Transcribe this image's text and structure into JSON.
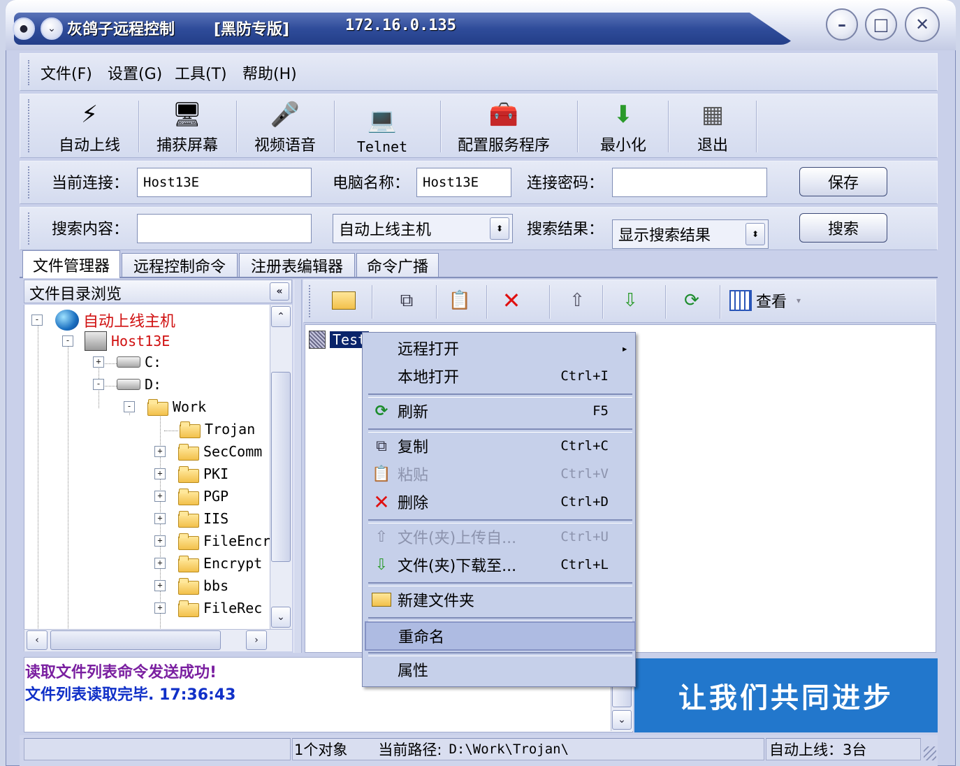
{
  "window": {
    "app_title": "灰鸽子远程控制",
    "edition": "[黑防专版]",
    "ip": "172.16.0.135",
    "min_label": "–",
    "max_label": "□",
    "close_label": "✕"
  },
  "menu": [
    "文件(F)",
    "设置(G)",
    "工具(T)",
    "帮助(H)"
  ],
  "toolbar": [
    {
      "label": "自动上线",
      "icon": "auto-online-icon",
      "glyph": "⚡"
    },
    {
      "label": "捕获屏幕",
      "icon": "capture-screen-icon",
      "glyph": "🖥"
    },
    {
      "label": "视频语音",
      "icon": "video-voice-icon",
      "glyph": "🎤"
    },
    {
      "label": "Telnet",
      "icon": "telnet-icon",
      "glyph": "💻"
    },
    {
      "label": "配置服务程序",
      "icon": "config-service-icon",
      "glyph": "🧰"
    },
    {
      "label": "最小化",
      "icon": "minimize-icon",
      "glyph": "⬇"
    },
    {
      "label": "退出",
      "icon": "exit-icon",
      "glyph": "▦"
    }
  ],
  "conn": {
    "current_label": "当前连接：",
    "current_value": "Host13E",
    "pcname_label": "电脑名称：",
    "pcname_value": "Host13E",
    "password_label": "连接密码：",
    "password_value": "",
    "save": "保存"
  },
  "search": {
    "content_label": "搜索内容：",
    "content_value": "",
    "scope_value": "自动上线主机",
    "result_label": "搜索结果：",
    "result_value": "显示搜索结果",
    "search": "搜索"
  },
  "tabs": [
    "文件管理器",
    "远程控制命令",
    "注册表编辑器",
    "命令广播"
  ],
  "tree": {
    "header": "文件目录浏览",
    "collapse": "«",
    "nodes": [
      {
        "label": "自动上线主机",
        "exp": "-"
      },
      {
        "label": "Host13E",
        "exp": "-"
      },
      {
        "label": "C:",
        "exp": "+"
      },
      {
        "label": "D:",
        "exp": "-"
      },
      {
        "label": "Work",
        "exp": "-"
      },
      {
        "label": "Trojan",
        "exp": ""
      },
      {
        "label": "SecComm",
        "exp": "+"
      },
      {
        "label": "PKI",
        "exp": "+"
      },
      {
        "label": "PGP",
        "exp": "+"
      },
      {
        "label": "IIS",
        "exp": "+"
      },
      {
        "label": "FileEncr",
        "exp": "+"
      },
      {
        "label": "Encrypt",
        "exp": "+"
      },
      {
        "label": "bbs",
        "exp": "+"
      },
      {
        "label": "FileRec",
        "exp": "+"
      }
    ]
  },
  "file_toolbar": {
    "view": "查看"
  },
  "files": [
    {
      "name": "Test"
    }
  ],
  "context_menu": [
    {
      "label": "远程打开",
      "key": "▸",
      "icon": "",
      "disabled": false
    },
    {
      "label": "本地打开",
      "key": "Ctrl+I",
      "icon": "",
      "disabled": false
    },
    {
      "label": "刷新",
      "key": "F5",
      "icon": "refresh-icon",
      "disabled": false
    },
    {
      "label": "复制",
      "key": "Ctrl+C",
      "icon": "copy-icon",
      "disabled": false
    },
    {
      "label": "粘贴",
      "key": "Ctrl+V",
      "icon": "paste-icon",
      "disabled": true
    },
    {
      "label": "删除",
      "key": "Ctrl+D",
      "icon": "delete-icon",
      "disabled": false
    },
    {
      "label": "文件(夹)上传自...",
      "key": "Ctrl+U",
      "icon": "upload-icon",
      "disabled": true
    },
    {
      "label": "文件(夹)下载至...",
      "key": "Ctrl+L",
      "icon": "download-icon",
      "disabled": false
    },
    {
      "label": "新建文件夹",
      "key": "",
      "icon": "new-folder-icon",
      "disabled": false
    },
    {
      "label": "重命名",
      "key": "",
      "icon": "",
      "disabled": false
    },
    {
      "label": "属性",
      "key": "",
      "icon": "",
      "disabled": false
    }
  ],
  "log": {
    "line1": "读取文件列表命令发送成功!",
    "line2": "文件列表读取完毕. 17:36:43"
  },
  "banner": "让我们共同进步",
  "statusbar": {
    "objects": "1个对象",
    "path_label": "当前路径:",
    "path_value": "D:\\Work\\Trojan\\",
    "online": "自动上线：3台"
  },
  "colors": {
    "title_bg": "#2f4c9a",
    "tree_red": "#d01010",
    "log_purple": "#7a1fa0",
    "log_blue": "#1030c8",
    "banner_bg": "#2277cc"
  }
}
